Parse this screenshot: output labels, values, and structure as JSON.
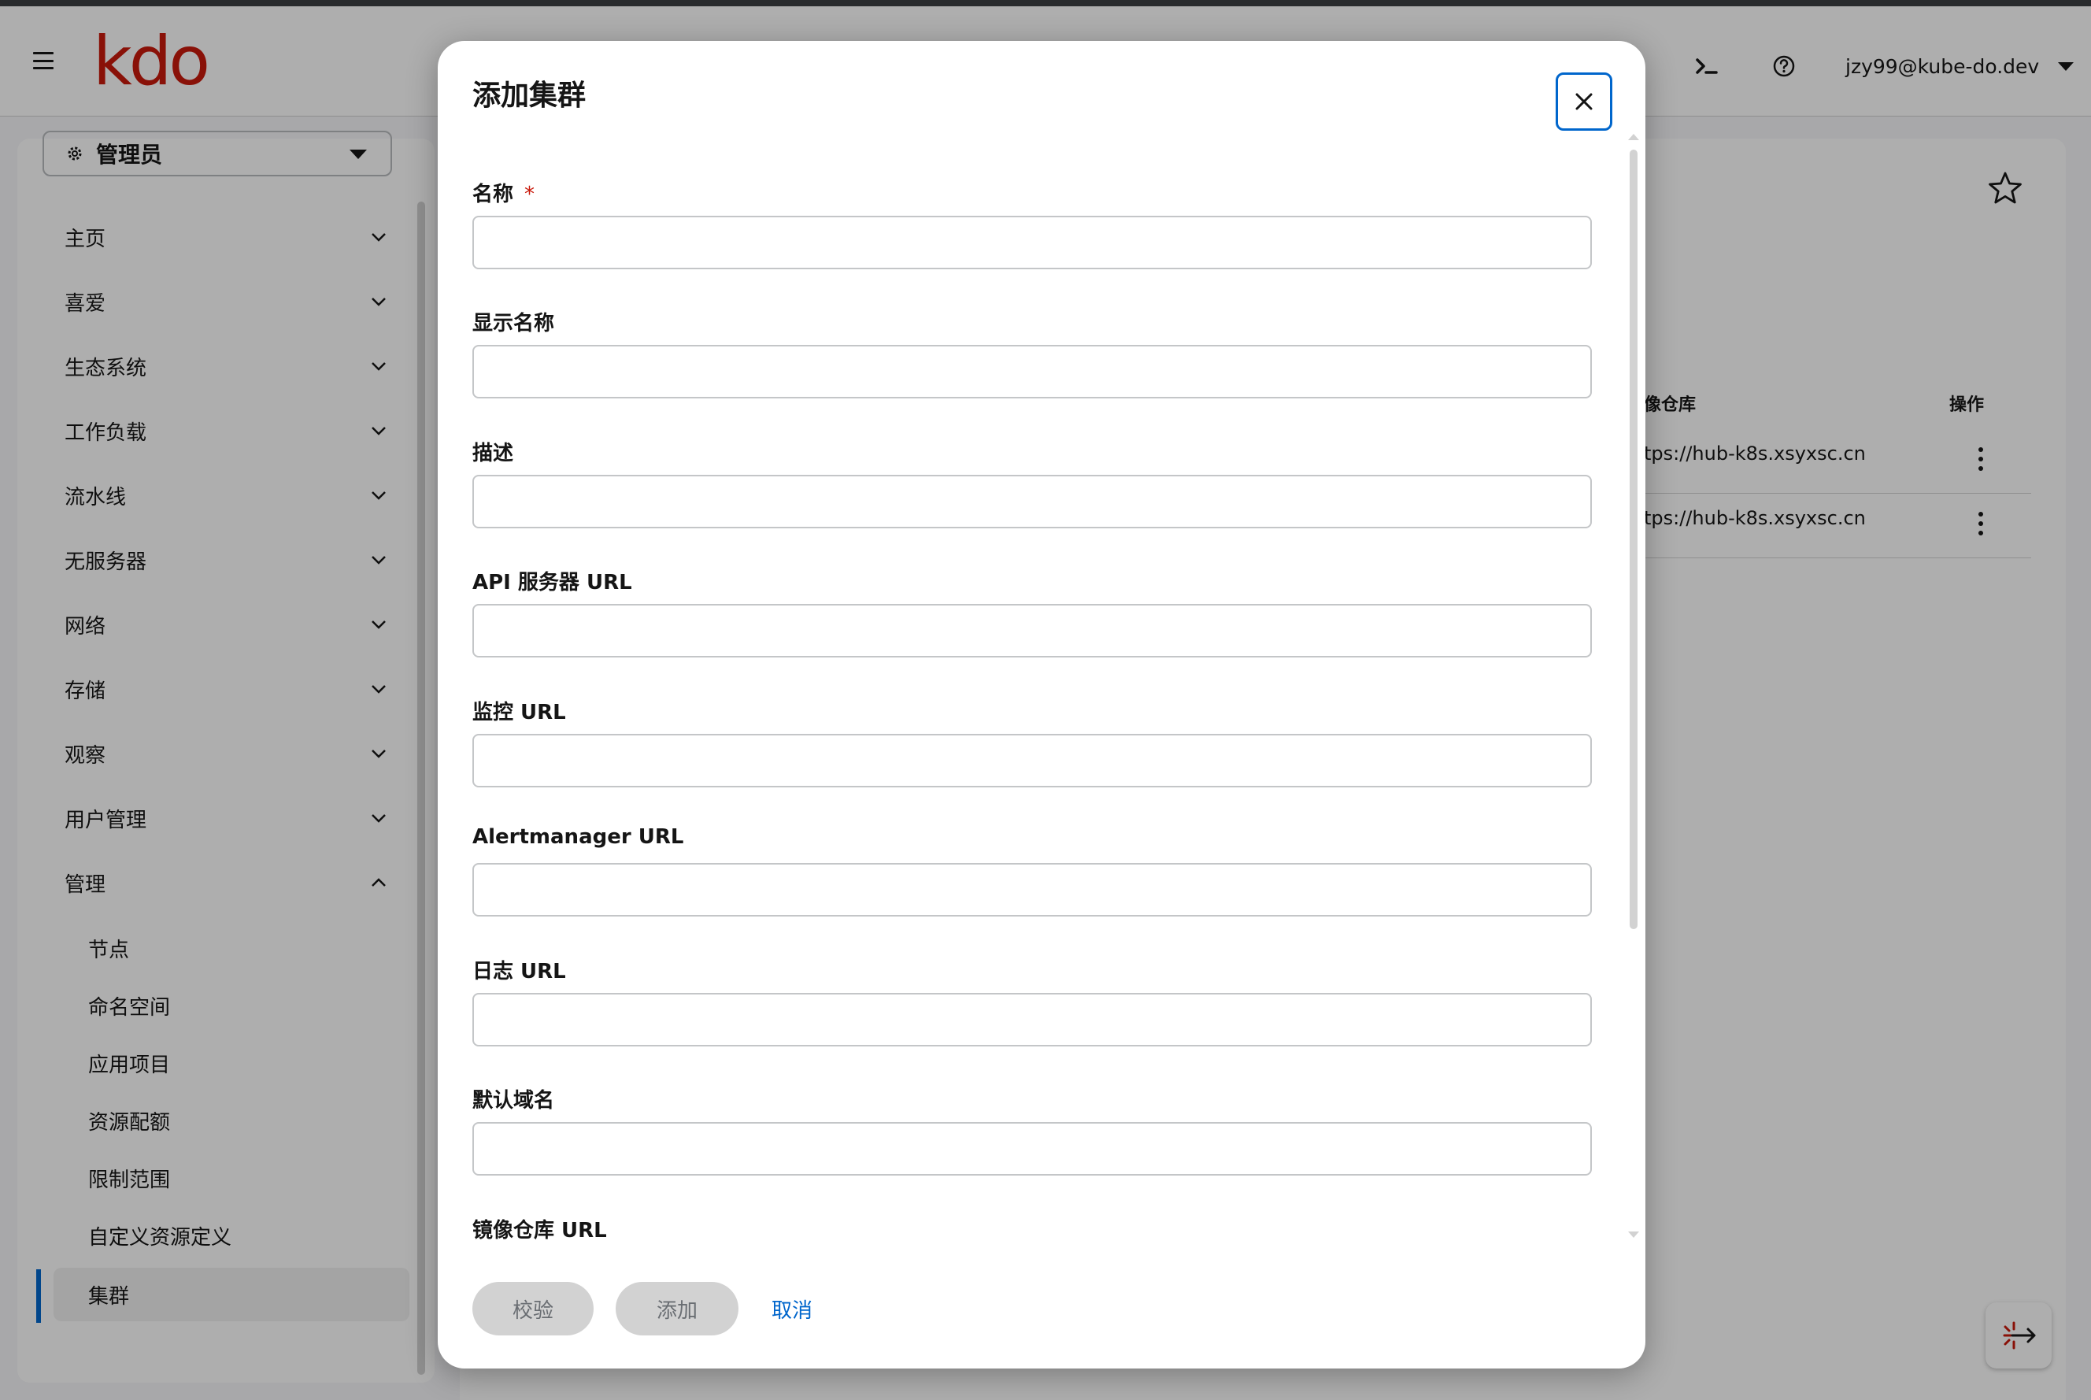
{
  "header": {
    "brand": "kdo",
    "user": "jzy99@kube-do.dev",
    "icons": {
      "menu": "hamburger-icon",
      "terminal": "terminal-icon",
      "help": "help-icon"
    }
  },
  "sidebar": {
    "perspective": "管理员",
    "items": [
      {
        "label": "主页",
        "expanded": false
      },
      {
        "label": "喜爱",
        "expanded": false
      },
      {
        "label": "生态系统",
        "expanded": false
      },
      {
        "label": "工作负载",
        "expanded": false
      },
      {
        "label": "流水线",
        "expanded": false
      },
      {
        "label": "无服务器",
        "expanded": false
      },
      {
        "label": "网络",
        "expanded": false
      },
      {
        "label": "存储",
        "expanded": false
      },
      {
        "label": "观察",
        "expanded": false
      },
      {
        "label": "用户管理",
        "expanded": false
      },
      {
        "label": "管理",
        "expanded": true
      }
    ],
    "subitems": [
      "节点",
      "命名空间",
      "应用项目",
      "资源配额",
      "限制范围",
      "自定义资源定义",
      "集群"
    ],
    "active": "集群"
  },
  "background_table": {
    "columns": [
      "像仓库",
      "操作"
    ],
    "rows": [
      {
        "registry": "tps://hub-k8s.xsyxsc.cn"
      },
      {
        "registry": "tps://hub-k8s.xsyxsc.cn"
      }
    ]
  },
  "modal": {
    "title": "添加集群",
    "required_mark": "*",
    "fields": [
      {
        "label": "名称",
        "required": true,
        "value": ""
      },
      {
        "label": "显示名称",
        "required": false,
        "value": ""
      },
      {
        "label": "描述",
        "required": false,
        "value": ""
      },
      {
        "label": "API 服务器 URL",
        "required": false,
        "value": ""
      },
      {
        "label": "监控 URL",
        "required": false,
        "value": ""
      },
      {
        "label": "Alertmanager URL",
        "required": false,
        "value": ""
      },
      {
        "label": "日志 URL",
        "required": false,
        "value": ""
      },
      {
        "label": "默认域名",
        "required": false,
        "value": ""
      },
      {
        "label": "镜像仓库 URL",
        "required": false,
        "value": ""
      }
    ],
    "buttons": {
      "verify": "校验",
      "add": "添加",
      "cancel": "取消"
    }
  },
  "colors": {
    "brand": "#c9190b",
    "link": "#0066cc",
    "required": "#c9190b"
  }
}
